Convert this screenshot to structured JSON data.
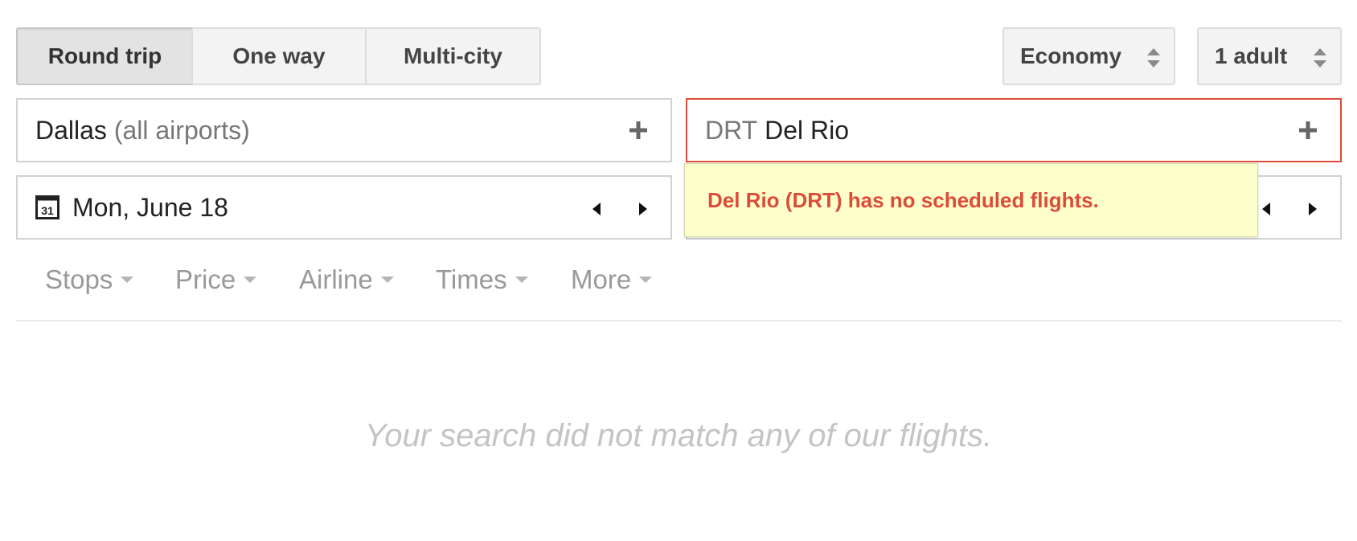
{
  "trip_type": {
    "options": [
      "Round trip",
      "One way",
      "Multi-city"
    ],
    "selected": "Round trip"
  },
  "cabin": {
    "label": "Economy"
  },
  "passengers": {
    "label": "1 adult"
  },
  "origin": {
    "city": "Dallas",
    "detail": "(all airports)"
  },
  "destination": {
    "code": "DRT",
    "city": "Del Rio"
  },
  "depart": {
    "date": "Mon, June 18"
  },
  "error_message": "Del Rio (DRT) has no scheduled flights.",
  "filters": [
    "Stops",
    "Price",
    "Airline",
    "Times",
    "More"
  ],
  "empty_state": "Your search did not match any of our flights.",
  "icons": {
    "calendar": "calendar-icon",
    "calendar_day": "31",
    "add": "plus-icon",
    "prev": "left-triangle-icon",
    "next": "right-triangle-icon",
    "select": "up-down-arrows-icon",
    "filter": "caret-down-icon"
  },
  "colors": {
    "error": "#dd4b39",
    "tooltip_bg": "#ffffcc",
    "button_bg": "#f3f3f3",
    "muted_text": "#999999"
  }
}
